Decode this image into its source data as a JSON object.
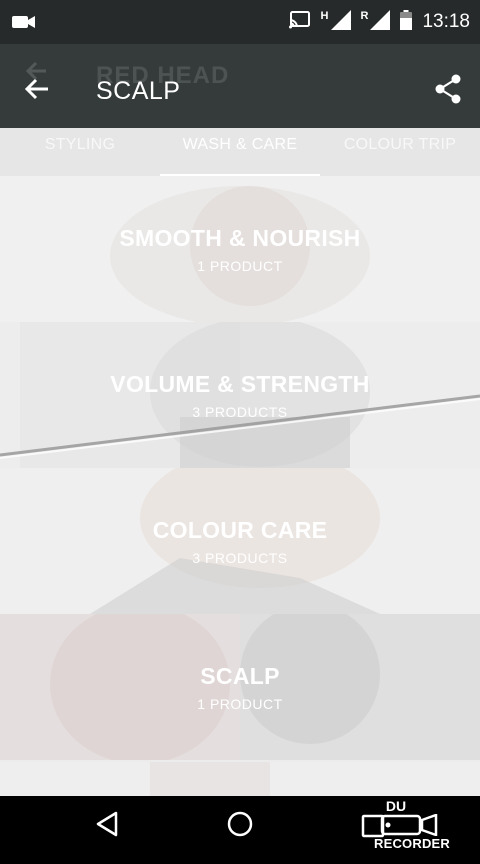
{
  "status_bar": {
    "time": "13:18",
    "network_letter": "H",
    "roaming_letter": "R",
    "icons": [
      "video-camera-icon",
      "cast-icon",
      "signal-icon",
      "signal-roaming-icon",
      "battery-icon"
    ]
  },
  "app_bar": {
    "title": "SCALP",
    "ghost_title": "RED HEAD",
    "back_icon": "arrow-back-icon",
    "share_icon": "share-icon"
  },
  "tabs": [
    {
      "label": "STYLING",
      "active": false
    },
    {
      "label": "WASH & CARE",
      "active": true
    },
    {
      "label": "COLOUR TRIP",
      "active": false
    }
  ],
  "categories": [
    {
      "name": "SMOOTH & NOURISH",
      "count": "1 PRODUCT"
    },
    {
      "name": "VOLUME & STRENGTH",
      "count": "3 PRODUCTS"
    },
    {
      "name": "COLOUR CARE",
      "count": "3 PRODUCTS"
    },
    {
      "name": "SCALP",
      "count": "1 PRODUCT"
    }
  ],
  "nav_bar": {
    "icons": [
      "back-triangle-icon",
      "home-circle-icon",
      "recents-square-icon"
    ]
  },
  "recorder": {
    "brand": "DU",
    "label": "RECORDER"
  },
  "colors": {
    "status_bar": "#262a2a",
    "app_bar": "#353b3b",
    "tab_strip": "#e6e6e6",
    "content_bg": "#efefef",
    "nav_bar": "#000000"
  }
}
